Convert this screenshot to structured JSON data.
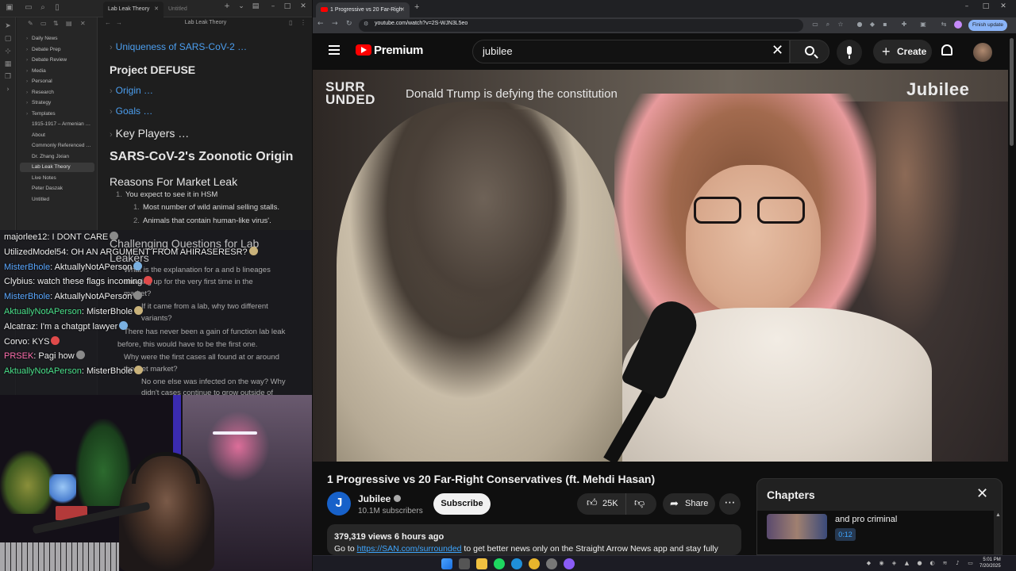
{
  "obsidian": {
    "tab_active": "Lab Leak Theory",
    "tab_inactive": "Untitled",
    "editor_title": "Lab Leak Theory",
    "tree_items": [
      {
        "label": "Daily News",
        "folder": true
      },
      {
        "label": "Debate Prep",
        "folder": true
      },
      {
        "label": "Debate Review",
        "folder": true
      },
      {
        "label": "Media",
        "folder": true
      },
      {
        "label": "Personal",
        "folder": true
      },
      {
        "label": "Research",
        "folder": true
      },
      {
        "label": "Strategy",
        "folder": true
      },
      {
        "label": "Templates",
        "folder": true
      },
      {
        "label": "1915-1917 – Armenian …",
        "folder": false
      },
      {
        "label": "About",
        "folder": false
      },
      {
        "label": "Commonly Referenced …",
        "folder": false
      },
      {
        "label": "Dr. Zhang Jixian",
        "folder": false
      },
      {
        "label": "Lab Leak Theory",
        "folder": false,
        "active": true
      },
      {
        "label": "Live Notes",
        "folder": false
      },
      {
        "label": "Peter Daszak",
        "folder": false
      },
      {
        "label": "Untitled",
        "folder": false
      }
    ],
    "headings": {
      "uniqueness": "Uniqueness of SARS-CoV-2 …",
      "defuse": "Project DEFUSE",
      "origin": "Origin …",
      "goals": "Goals …",
      "key_players": "Key Players …",
      "zoonotic": "SARS-CoV-2's Zoonotic Origin",
      "reasons": "Reasons For Market Leak",
      "challenging": "Challenging Questions for Lab",
      "challenging2": "Leakers"
    },
    "list": {
      "item1": "You expect to see it in HSM",
      "item1a": "Most number of wild animal selling stalls.",
      "item1b": "Animals that contain human-like virus'.",
      "q1a": "What is the explanation for a and b lineages",
      "q1b": "showing up for the very first time in the",
      "q1c": "market?",
      "q2a": "If it came from a lab, why two different",
      "q2b": "variants?",
      "q3a": "There has never been a gain of function lab leak",
      "q3b": "before, this would have to be the first one.",
      "q4a": "Why were the first cases all found at or around",
      "q4b": "the wet market?",
      "q5a": "No one else was infected on the way? Why",
      "q5b": "didn't cases continue to grow outside of"
    }
  },
  "chat": [
    {
      "user": "majorlee12",
      "color": "#f0f0f0",
      "text": ": I DONT CARE"
    },
    {
      "user": "UtilizedModel54",
      "color": "#f0f0f0",
      "text": ": OH AN ARGUMENT FROM AHIRASERESR?"
    },
    {
      "user": "MisterBhole",
      "color": "#5aa7ff",
      "text": ": AktuallyNotAPerson"
    },
    {
      "user": "Clybius",
      "color": "#f0f0f0",
      "text": ": watch these flags incoming"
    },
    {
      "user": "MisterBhole",
      "color": "#5aa7ff",
      "text": ": AktuallyNotAPerson"
    },
    {
      "user": "AktuallyNotAPerson",
      "color": "#4ae08a",
      "text": ": MisterBhole"
    },
    {
      "user": "Alcatraz",
      "color": "#f0f0f0",
      "text": ": I'm a chatgpt lawyer"
    },
    {
      "user": "Corvo",
      "color": "#f0f0f0",
      "text": ": KYS"
    },
    {
      "user": "PRSEK",
      "color": "#ff6fae",
      "text": ": Pagi how"
    },
    {
      "user": "AktuallyNotAPerson",
      "color": "#4ae08a",
      "text": ": MisterBhole"
    }
  ],
  "browser": {
    "tab_title": "1 Progressive vs 20 Far-Righ",
    "url": "youtube.com/watch?v=2S-WJN3L5eo",
    "finish_update": "Finish update"
  },
  "youtube": {
    "brand": "Premium",
    "search_value": "jubilee",
    "create_label": "Create",
    "video": {
      "overlay_brand_left": "SURR UNDED",
      "overlay_title": "Donald Trump is defying the constitution",
      "overlay_brand_right": "Jubilee"
    },
    "title": "1 Progressive vs 20 Far-Right Conservatives (ft. Mehdi Hasan)",
    "channel": {
      "avatar_letter": "J",
      "name": "Jubilee",
      "subscribers": "10.1M subscribers",
      "subscribe_label": "Subscribe"
    },
    "likes": "25K",
    "share_label": "Share",
    "description": {
      "meta": "379,319 views  6 hours ago",
      "prefix": "Go to ",
      "link": "https://SAN.com/surrounded",
      "suffix": " to get better news only on the Straight Arrow News app and stay fully"
    },
    "chapters": {
      "title": "Chapters",
      "item_title": "and pro criminal",
      "item_time": "0:12"
    }
  },
  "taskbar": {
    "time": "5:01 PM",
    "date": "7/20/2025"
  }
}
